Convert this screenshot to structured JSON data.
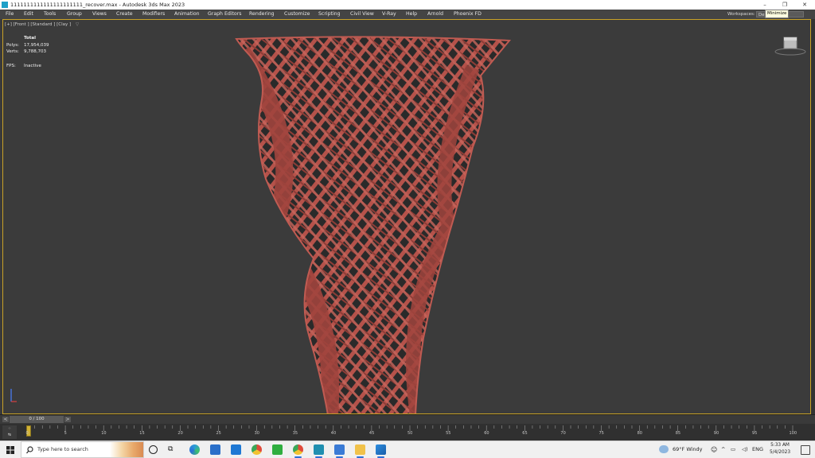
{
  "window": {
    "title": "1111111111111111111111_recover.max - Autodesk 3ds Max 2023",
    "minimize": "–",
    "restore": "❐",
    "close": "✕",
    "tooltip": "Minimize"
  },
  "menu": {
    "items": [
      "File",
      "Edit",
      "Tools",
      "Group",
      "Views",
      "Create",
      "Modifiers",
      "Animation",
      "Graph Editors",
      "Rendering",
      "Customize",
      "Scripting",
      "Civil View",
      "V-Ray",
      "Help",
      "Arnold",
      "Phoenix FD"
    ],
    "workspaces_label": "Workspaces:",
    "workspaces_value": "De"
  },
  "viewport": {
    "label": "[+] [Front ] [Standard ] [Clay ]",
    "filter_icon": "funnel-icon",
    "stats": {
      "header": "Total",
      "polys_label": "Polys:",
      "polys": "17,954,039",
      "verts_label": "Verts:",
      "verts": "9,788,703",
      "fps_label": "FPS:",
      "fps": "Inactive"
    },
    "object_color": "#b5524a",
    "border_color": "#c9a227"
  },
  "timeline": {
    "frame": "0 / 100",
    "prev": "<",
    "next": ">"
  },
  "trackbar": {
    "icon_label": "⁘\n↹",
    "ticks": [
      "0",
      "5",
      "10",
      "15",
      "20",
      "25",
      "30",
      "35",
      "40",
      "45",
      "50",
      "55",
      "60",
      "65",
      "70",
      "75",
      "80",
      "85",
      "90",
      "95",
      "100"
    ]
  },
  "taskbar": {
    "search_placeholder": "Type here to search",
    "icons": [
      "cortana-icon",
      "task-view-icon",
      "edge-icon",
      "store-icon",
      "mail-icon",
      "chrome-icon",
      "camtasia-icon",
      "chrome-profile-icon",
      "3dsmax-icon",
      "app-icon",
      "file-explorer-icon",
      "photos-icon"
    ],
    "weather": "69°F  Windy",
    "language": "ENG",
    "time": "5:33 AM",
    "date": "5/4/2023"
  }
}
